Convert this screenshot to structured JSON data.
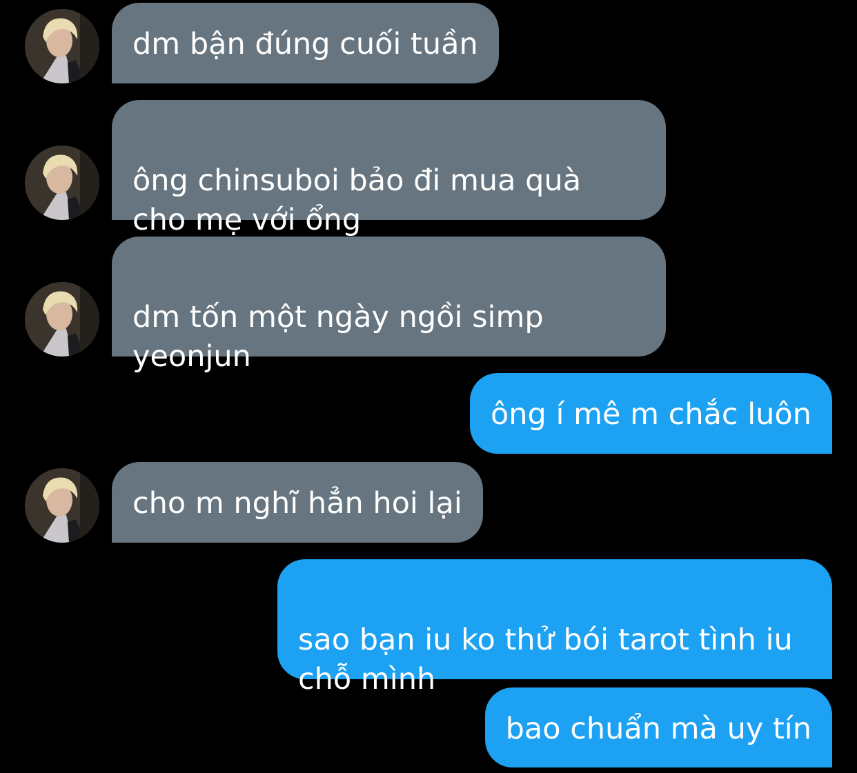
{
  "conversation": {
    "messages": [
      {
        "direction": "incoming",
        "text": "dm bận đúng cuối tuần",
        "avatar": "contact-avatar"
      },
      {
        "direction": "incoming",
        "text": "ông chinsuboi bảo đi mua quà\ncho mẹ với ổng",
        "avatar": "contact-avatar"
      },
      {
        "direction": "incoming",
        "text": "dm tốn một ngày ngồi simp\nyeonjun",
        "avatar": "contact-avatar"
      },
      {
        "direction": "outgoing",
        "text": "ông í mê m chắc luôn"
      },
      {
        "direction": "incoming",
        "text": "cho m nghĩ hẳn hoi lại",
        "avatar": "contact-avatar"
      },
      {
        "direction": "outgoing",
        "text": "sao bạn iu ko thử bói tarot tình iu\nchỗ mình"
      },
      {
        "direction": "outgoing",
        "text": "bao chuẩn mà uy tín"
      }
    ]
  },
  "colors": {
    "background": "#000000",
    "incoming_bubble": "#66757f",
    "outgoing_bubble": "#1da1f2",
    "text": "#ffffff"
  }
}
